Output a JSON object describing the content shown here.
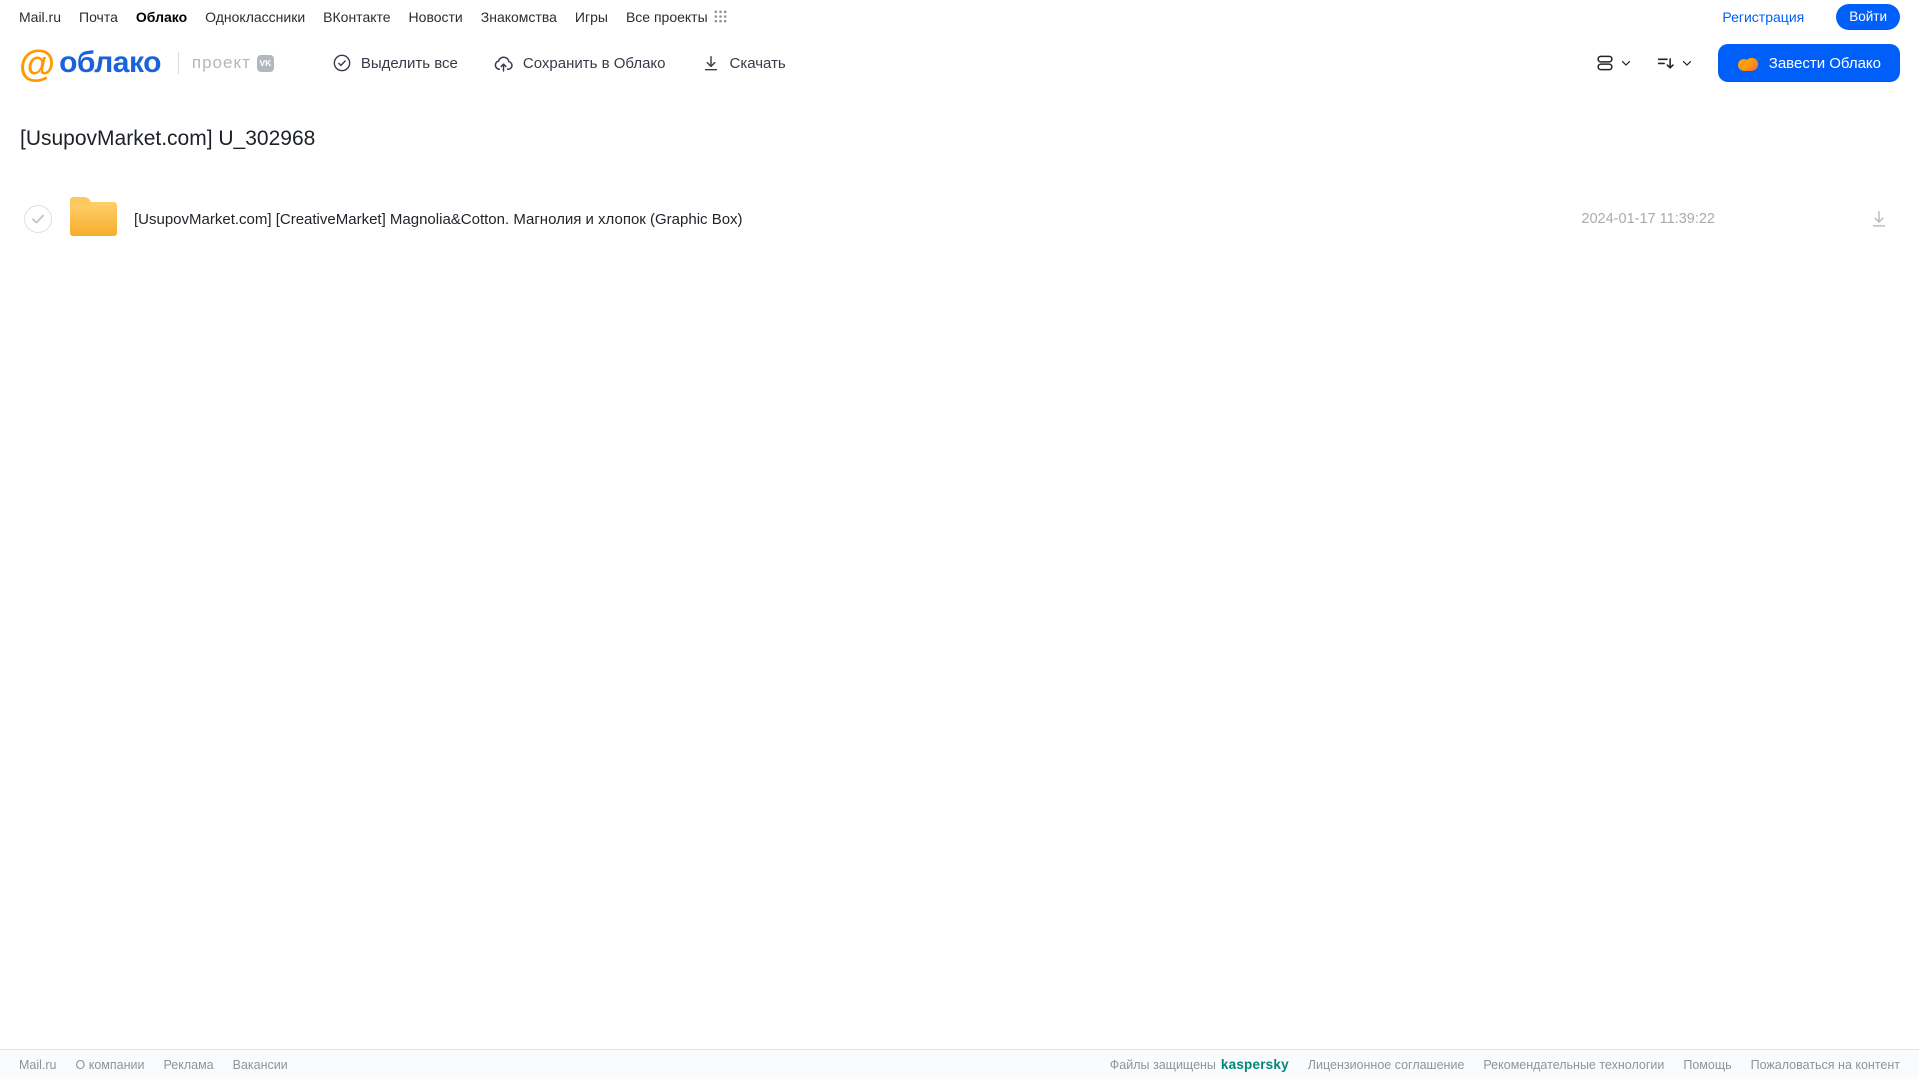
{
  "topnav": {
    "links": [
      "Mail.ru",
      "Почта",
      "Облако",
      "Одноклассники",
      "ВКонтакте",
      "Новости",
      "Знакомства",
      "Игры",
      "Все проекты"
    ],
    "active_link": "Облако",
    "register_label": "Регистрация",
    "login_label": "Войти"
  },
  "header": {
    "logo_at": "@",
    "logo_text": "облако",
    "project_label": "проект",
    "vk_badge_label": "VK",
    "actions": {
      "select_all": "Выделить все",
      "save_to_cloud": "Сохранить в Облако",
      "download": "Скачать"
    },
    "create_cloud_label": "Завести Облако"
  },
  "main": {
    "title": "[UsupovMarket.com] U_302968",
    "files": [
      {
        "type": "folder",
        "name": "[UsupovMarket.com] [CreativeMarket] Magnolia&Cotton. Магнолия и хлопок (Graphic Box)",
        "modified": "2024-01-17 11:39:22"
      }
    ]
  },
  "footer": {
    "left_links": [
      "Mail.ru",
      "О компании",
      "Реклама",
      "Вакансии"
    ],
    "protected_label": "Файлы защищены",
    "kaspersky_label": "kaspersky",
    "right_links": [
      "Лицензионное соглашение",
      "Рекомендательные технологии",
      "Помощь",
      "Пожаловаться на контент"
    ]
  },
  "colors": {
    "accent_blue": "#005ff9",
    "logo_blue": "#1b63dc",
    "logo_orange": "#ff9900",
    "folder_yellow": "#f7b733",
    "kaspersky_green": "#00877c",
    "muted_text": "#a7abb0"
  }
}
